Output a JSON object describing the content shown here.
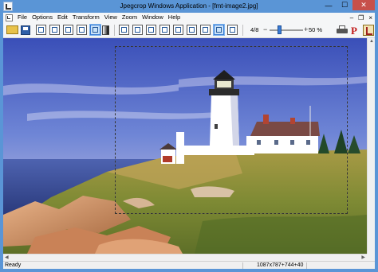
{
  "window": {
    "title": "Jpegcrop Windows Application - [fmt-image2.jpg]",
    "minimize_glyph": "—",
    "maximize_glyph": "☐",
    "close_glyph": "✕"
  },
  "menu": {
    "items": [
      "File",
      "Options",
      "Edit",
      "Transform",
      "View",
      "Zoom",
      "Window",
      "Help"
    ],
    "mdi_minimize": "–",
    "mdi_restore": "❐",
    "mdi_close": "×"
  },
  "toolbar": {
    "icons": [
      "open-icon",
      "save-icon",
      "crop-icon",
      "grid-icon",
      "frame-icon",
      "resize-icon",
      "select-icon",
      "gradient-icon",
      "rotate-left-icon",
      "rotate-right-icon",
      "flip-horizontal-icon",
      "flip-vertical-icon",
      "transpose-icon",
      "transverse-icon",
      "rotate-180-icon",
      "fit-icon",
      "actual-size-icon",
      "print-icon",
      "p-icon",
      "about-icon"
    ],
    "page_counter": "4/8",
    "zoom_minus": "−",
    "zoom_plus": "+",
    "zoom_level": 0.5,
    "zoom_label": "50 %",
    "p_glyph": "P"
  },
  "statusbar": {
    "status": "Ready",
    "dimensions": "1087x787+744+40"
  },
  "scroll": {
    "up_glyph": "▲",
    "left_glyph": "◀",
    "right_glyph": "▶"
  },
  "colors": {
    "titlebar": "#5a95d6",
    "close": "#c7504a",
    "accent": "#3a7bd5"
  }
}
